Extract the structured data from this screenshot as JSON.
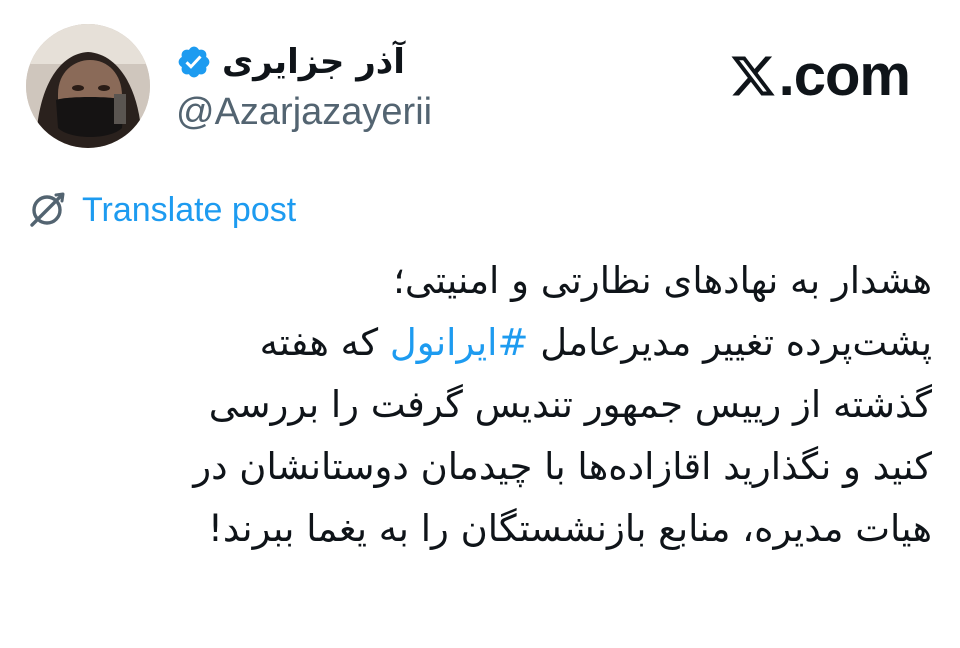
{
  "author": {
    "display_name": "آذر جزایری",
    "handle": "@Azarjazayerii",
    "verified": true,
    "avatar_icon": "profile-photo-masked-person"
  },
  "brand": {
    "text": ".com",
    "icon": "x-logo-icon"
  },
  "translate": {
    "label": "Translate post",
    "icon": "translate-globe-icon"
  },
  "post": {
    "line1": "هشدار به نهادهای نظارتی و امنیتی؛",
    "line2_before": "پشت‌پرده تغییر مدیرعامل ",
    "hashtag": "#ایرانول",
    "line2_after": " که هفته",
    "line3": "گذشته از رییس جمهور تندیس گرفت را بررسی",
    "line4": "کنید و نگذارید اقازاده‌ها با چیدمان دوستانشان در",
    "line5": "هیات مدیره، منابع بازنشستگان را به یغما ببرند!"
  },
  "colors": {
    "link": "#1d9bf0",
    "text": "#0f1419",
    "secondary": "#536471",
    "background": "#ffffff"
  }
}
